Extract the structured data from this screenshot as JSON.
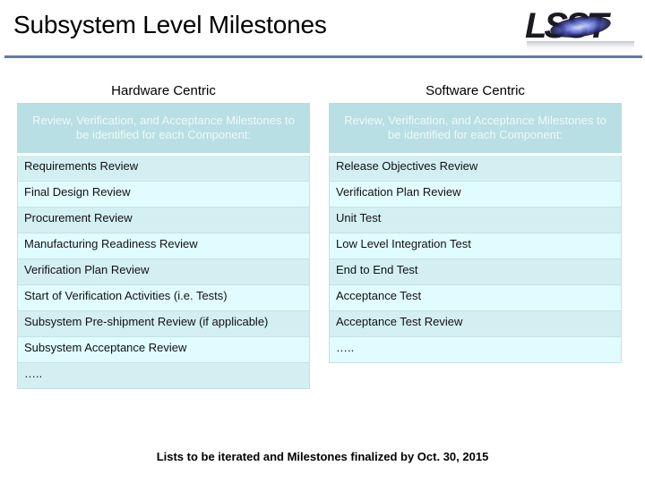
{
  "slide": {
    "title": "Subsystem Level Milestones",
    "logo_text": "LSST",
    "footer_note": "Lists to be iterated and Milestones finalized by Oct. 30, 2015"
  },
  "colors": {
    "rule": "#5b7fa8",
    "header_bg": "#b8dfe3",
    "row_odd_bg": "#d3eff2",
    "row_even_bg": "#e0fcff"
  },
  "hardware": {
    "heading": "Hardware Centric",
    "table_header": "Review, Verification, and Acceptance Milestones to be identified for each Component:",
    "rows": [
      "Requirements Review",
      "Final Design Review",
      "Procurement Review",
      "Manufacturing Readiness Review",
      "Verification Plan Review",
      "Start of Verification Activities (i.e. Tests)",
      "Subsystem Pre-shipment Review (if applicable)",
      "Subsystem Acceptance Review",
      "….."
    ]
  },
  "software": {
    "heading": "Software Centric",
    "table_header": "Review, Verification, and Acceptance Milestones to be identified for each Component:",
    "rows": [
      "Release Objectives Review",
      "Verification Plan Review",
      "Unit Test",
      "Low Level Integration Test",
      "End to End Test",
      "Acceptance Test",
      "Acceptance Test Review",
      "….."
    ]
  }
}
